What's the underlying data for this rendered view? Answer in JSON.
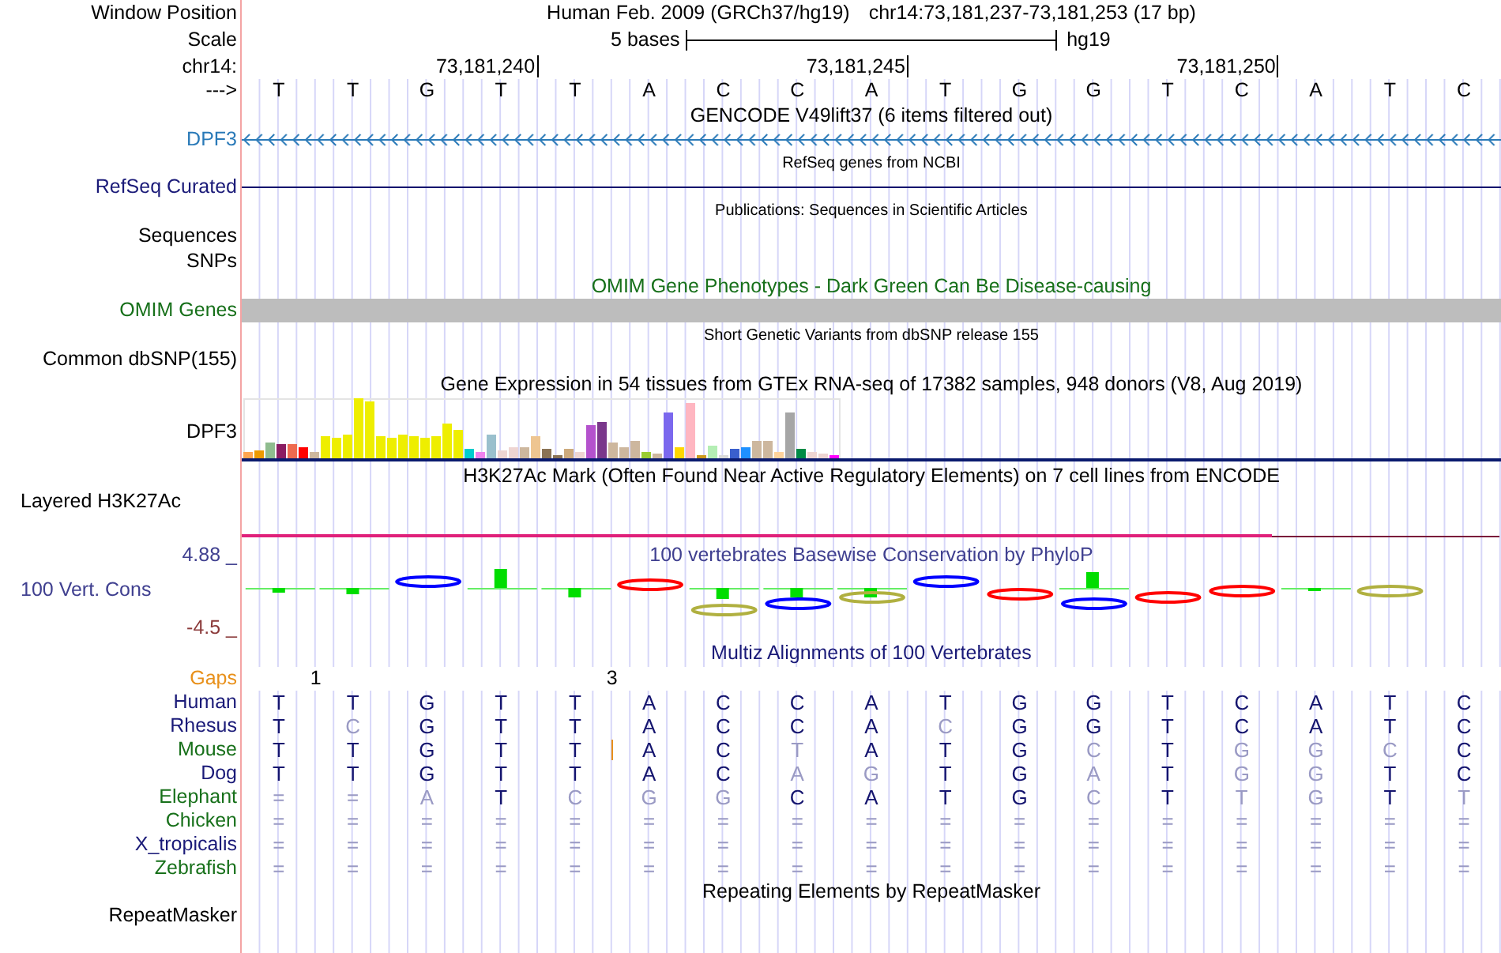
{
  "position": {
    "label": "Window Position",
    "assembly": "Human Feb. 2009 (GRCh37/hg19)",
    "range": "chr14:73,181,237-73,181,253 (17 bp)"
  },
  "scale": {
    "label": "Scale",
    "bar_label": "5 bases",
    "assembly": "hg19"
  },
  "ruler": {
    "label": "chr14:",
    "ticks": [
      "73,181,240",
      "73,181,245",
      "73,181,250"
    ]
  },
  "sequence": {
    "label": "--->",
    "bases": [
      "T",
      "T",
      "G",
      "T",
      "T",
      "A",
      "C",
      "C",
      "A",
      "T",
      "G",
      "G",
      "T",
      "C",
      "A",
      "T",
      "C"
    ]
  },
  "gencode": {
    "title": "GENCODE V49lift37 (6 items filtered out)",
    "label": "DPF3"
  },
  "refseq": {
    "title": "RefSeq genes from NCBI",
    "label": "RefSeq Curated"
  },
  "publications": {
    "title": "Publications: Sequences in Scientific Articles",
    "labels": [
      "Sequences",
      "SNPs"
    ]
  },
  "omim": {
    "title": "OMIM Gene Phenotypes - Dark Green Can Be Disease-causing",
    "label": "OMIM Genes"
  },
  "dbsnp": {
    "title": "Short Genetic Variants from dbSNP release 155",
    "label": "Common dbSNP(155)"
  },
  "gtex": {
    "title": "Gene Expression in 54 tissues from GTEx RNA-seq of 17382 samples, 948 donors (V8, Aug 2019)",
    "label": "DPF3"
  },
  "h3k27ac": {
    "title": "H3K27Ac Mark (Often Found Near Active Regulatory Elements) on 7 cell lines from ENCODE",
    "label": "Layered H3K27Ac"
  },
  "phylop": {
    "title": "100 vertebrates Basewise Conservation by PhyloP",
    "label": "100 Vert. Cons",
    "max": "4.88 _",
    "min": "-4.5 _"
  },
  "multiz": {
    "title": "Multiz Alignments of 100 Vertebrates",
    "gaps_label": "Gaps",
    "gaps": [
      "1",
      "3"
    ],
    "species": [
      {
        "name": "Human",
        "color": "#1a1a78",
        "bases": [
          "T",
          "T",
          "G",
          "T",
          "T",
          "A",
          "C",
          "C",
          "A",
          "T",
          "G",
          "G",
          "T",
          "C",
          "A",
          "T",
          "C"
        ],
        "matches": [
          true,
          true,
          true,
          true,
          true,
          true,
          true,
          true,
          true,
          true,
          true,
          true,
          true,
          true,
          true,
          true,
          true
        ]
      },
      {
        "name": "Rhesus",
        "color": "#1a1a78",
        "bases": [
          "T",
          "C",
          "G",
          "T",
          "T",
          "A",
          "C",
          "C",
          "A",
          "C",
          "G",
          "G",
          "T",
          "C",
          "A",
          "T",
          "C"
        ],
        "matches": [
          true,
          false,
          true,
          true,
          true,
          true,
          true,
          true,
          true,
          false,
          true,
          true,
          true,
          true,
          true,
          true,
          true
        ]
      },
      {
        "name": "Mouse",
        "color": "#17701a",
        "bases": [
          "T",
          "T",
          "G",
          "T",
          "T",
          "A",
          "C",
          "T",
          "A",
          "T",
          "G",
          "C",
          "T",
          "G",
          "G",
          "C",
          "C"
        ],
        "matches": [
          true,
          true,
          true,
          true,
          true,
          true,
          true,
          false,
          true,
          true,
          true,
          false,
          true,
          false,
          false,
          false,
          true
        ],
        "insertion": true
      },
      {
        "name": "Dog",
        "color": "#1a1a78",
        "bases": [
          "T",
          "T",
          "G",
          "T",
          "T",
          "A",
          "C",
          "A",
          "G",
          "T",
          "G",
          "A",
          "T",
          "G",
          "G",
          "T",
          "C"
        ],
        "matches": [
          true,
          true,
          true,
          true,
          true,
          true,
          true,
          false,
          false,
          true,
          true,
          false,
          true,
          false,
          false,
          true,
          true
        ]
      },
      {
        "name": "Elephant",
        "color": "#17701a",
        "bases": [
          "=",
          "=",
          "A",
          "T",
          "C",
          "G",
          "G",
          "C",
          "A",
          "T",
          "G",
          "C",
          "T",
          "T",
          "G",
          "T",
          "T"
        ],
        "matches": [
          false,
          false,
          false,
          true,
          false,
          false,
          false,
          true,
          true,
          true,
          true,
          false,
          true,
          false,
          false,
          true,
          false
        ]
      },
      {
        "name": "Chicken",
        "color": "#17701a",
        "bases": [
          "=",
          "=",
          "=",
          "=",
          "=",
          "=",
          "=",
          "=",
          "=",
          "=",
          "=",
          "=",
          "=",
          "=",
          "=",
          "=",
          "="
        ],
        "matches": [
          false,
          false,
          false,
          false,
          false,
          false,
          false,
          false,
          false,
          false,
          false,
          false,
          false,
          false,
          false,
          false,
          false
        ]
      },
      {
        "name": "X_tropicalis",
        "color": "#1a1a78",
        "bases": [
          "=",
          "=",
          "=",
          "=",
          "=",
          "=",
          "=",
          "=",
          "=",
          "=",
          "=",
          "=",
          "=",
          "=",
          "=",
          "=",
          "="
        ],
        "matches": [
          false,
          false,
          false,
          false,
          false,
          false,
          false,
          false,
          false,
          false,
          false,
          false,
          false,
          false,
          false,
          false,
          false
        ]
      },
      {
        "name": "Zebrafish",
        "color": "#17701a",
        "bases": [
          "=",
          "=",
          "=",
          "=",
          "=",
          "=",
          "=",
          "=",
          "=",
          "=",
          "=",
          "=",
          "=",
          "=",
          "=",
          "=",
          "="
        ],
        "matches": [
          false,
          false,
          false,
          false,
          false,
          false,
          false,
          false,
          false,
          false,
          false,
          false,
          false,
          false,
          false,
          false,
          false
        ]
      }
    ]
  },
  "repeatmasker": {
    "title": "Repeating Elements by RepeatMasker",
    "label": "RepeatMasker"
  }
}
